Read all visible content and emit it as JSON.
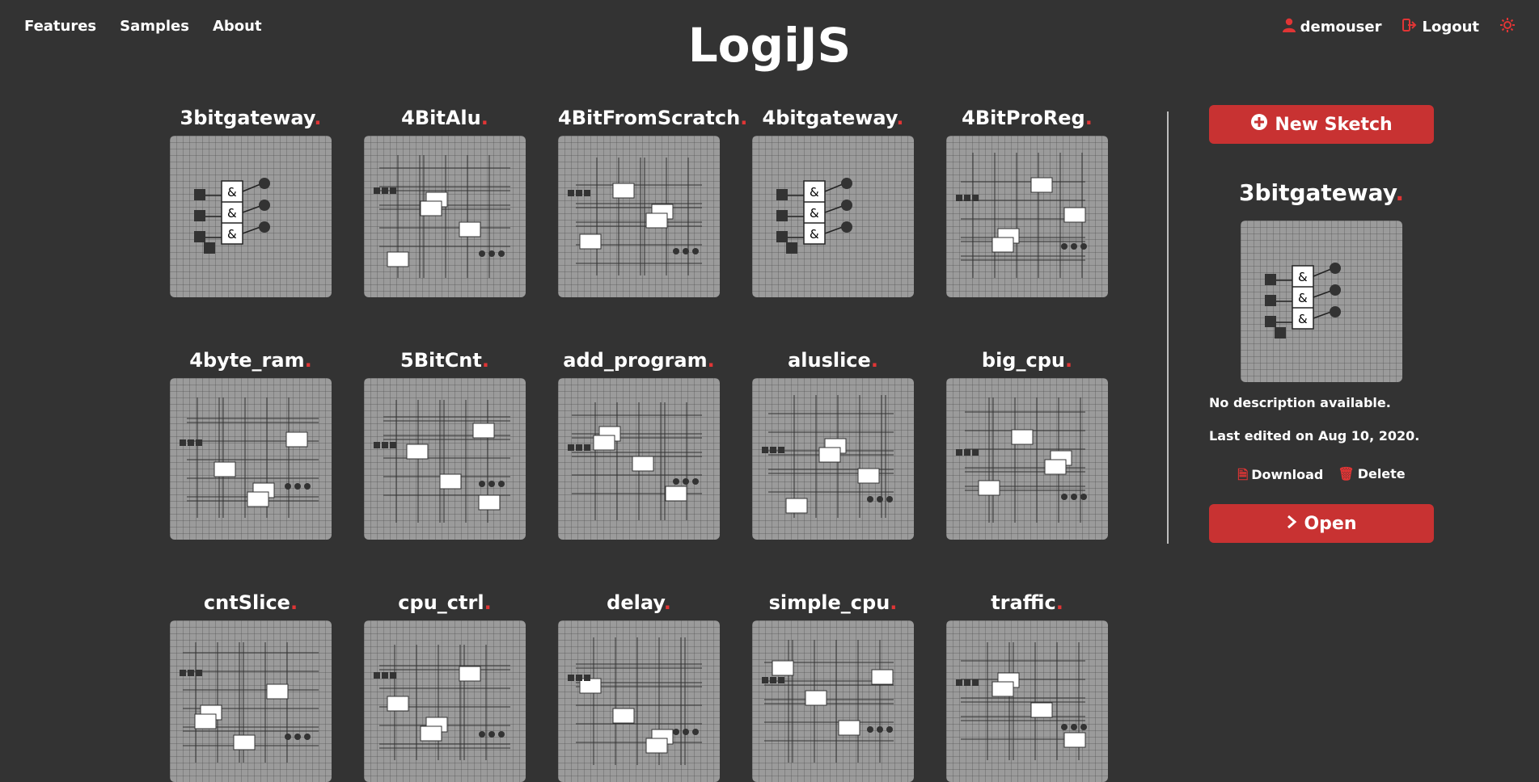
{
  "nav": {
    "features": "Features",
    "samples": "Samples",
    "about": "About"
  },
  "logo": {
    "text": "Logi",
    "text2": "JS"
  },
  "user": {
    "name": "demouser",
    "logout": "Logout"
  },
  "sketches": [
    {
      "name": "3bitgateway"
    },
    {
      "name": "4BitAlu"
    },
    {
      "name": "4BitFromScratch"
    },
    {
      "name": "4bitgateway"
    },
    {
      "name": "4BitProReg"
    },
    {
      "name": "4byte_ram"
    },
    {
      "name": "5BitCnt"
    },
    {
      "name": "add_program"
    },
    {
      "name": "aluslice"
    },
    {
      "name": "big_cpu"
    },
    {
      "name": "cntSlice"
    },
    {
      "name": "cpu_ctrl"
    },
    {
      "name": "delay"
    },
    {
      "name": "simple_cpu"
    },
    {
      "name": "traffic"
    }
  ],
  "sidebar": {
    "new_sketch": "New Sketch",
    "selected_title": "3bitgateway",
    "description": "No description available.",
    "last_edited": "Last edited on Aug 10, 2020.",
    "download": "Download",
    "delete": "Delete",
    "open": "Open"
  },
  "colors": {
    "accent": "#c83232",
    "dot": "#e03535",
    "background": "#333333",
    "thumb": "#9b9b9b"
  }
}
